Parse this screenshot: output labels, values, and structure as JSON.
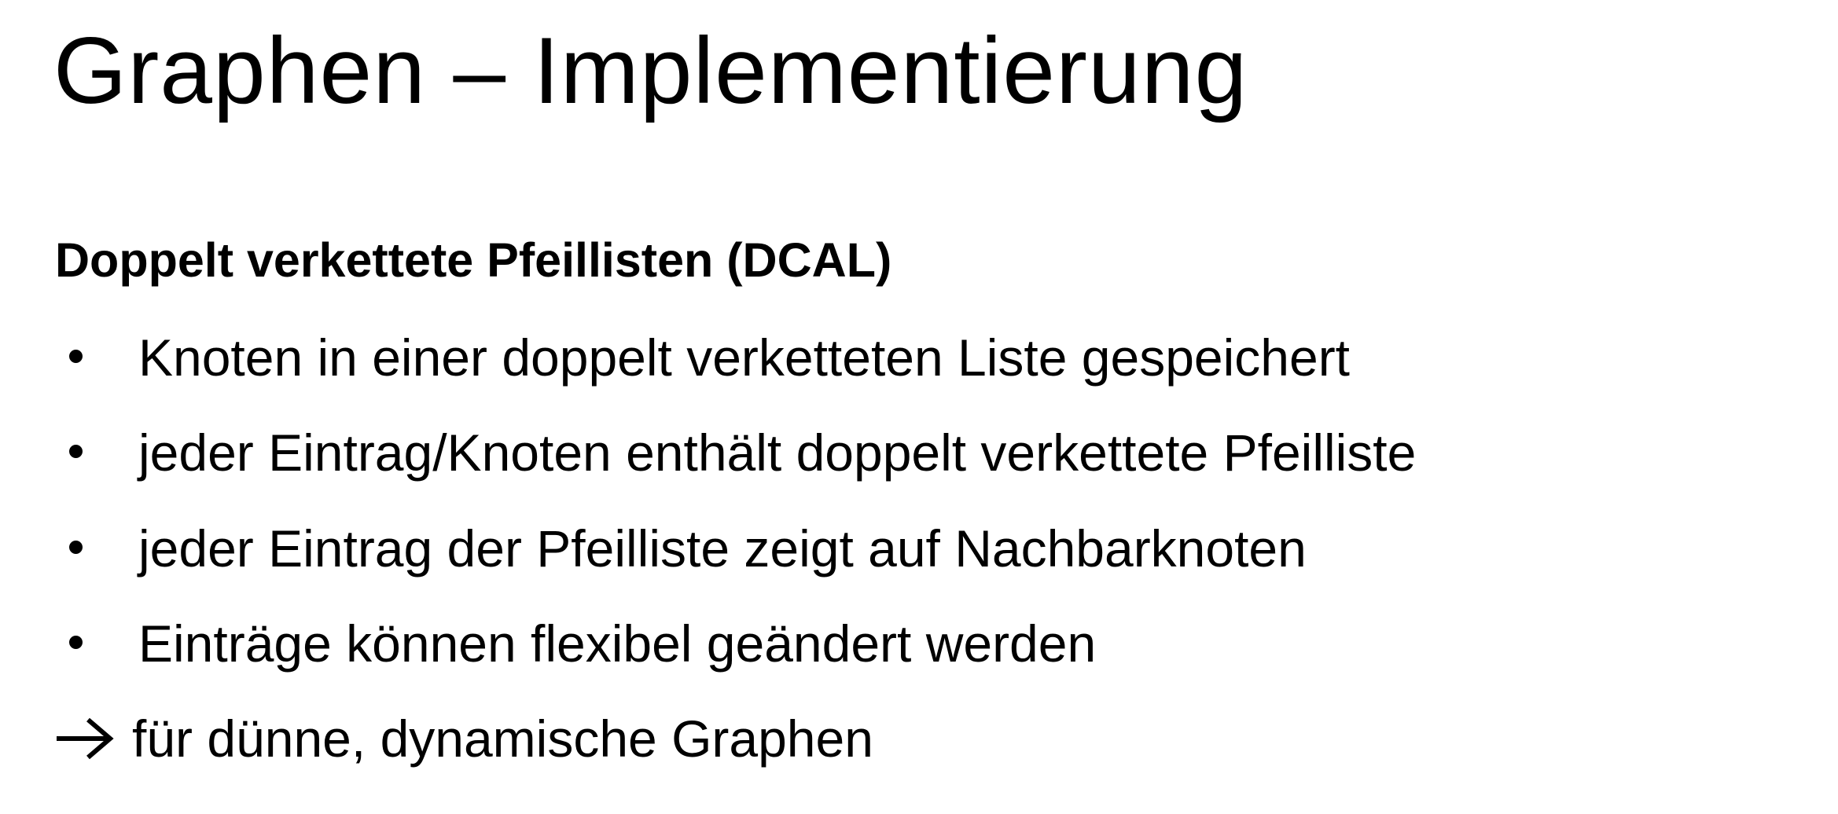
{
  "slide": {
    "title": "Graphen – Implementierung",
    "subtitle": "Doppelt verkettete Pfeillisten (DCAL)",
    "bullets": [
      {
        "text": "Knoten in einer doppelt verketteten Liste gespeichert"
      },
      {
        "text": "jeder Eintrag/Knoten enthält doppelt verkettete Pfeilliste"
      },
      {
        "text": "jeder Eintrag der Pfeilliste zeigt auf Nachbarknoten"
      },
      {
        "text": "Einträge können flexibel geändert werden"
      }
    ],
    "conclusion": {
      "icon": "arrow-right-icon",
      "text": "für dünne, dynamische Graphen"
    }
  }
}
